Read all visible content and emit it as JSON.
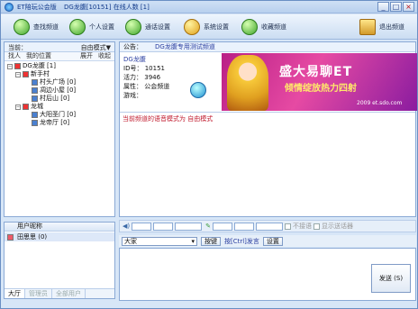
{
  "window": {
    "app_name": "ET陪玩公会版",
    "channel_info": "DG龙腹[10151] 在线人数 [1]",
    "minimize": "_",
    "maximize": "□",
    "close": "×"
  },
  "toolbar": {
    "find_channel": "查找频道",
    "personal_settings": "个人设置",
    "call_settings": "通话设置",
    "system_settings": "系统设置",
    "favorite_channel": "收藏频道",
    "exit_channel": "退出频道"
  },
  "left": {
    "current_label": "当前：",
    "mode_value": "自由模式▼",
    "tab_find": "找人",
    "tab_my_position": "我的位置",
    "expand": "展开",
    "collapse": "收起",
    "tree": [
      {
        "label": "DG龙腹 [1]",
        "level": 0,
        "icon": "red"
      },
      {
        "label": "新手村",
        "level": 1,
        "icon": "red"
      },
      {
        "label": "村头广场 [0]",
        "level": 2,
        "icon": "blue"
      },
      {
        "label": "凋边小屋 [0]",
        "level": 2,
        "icon": "blue"
      },
      {
        "label": "村后山 [0]",
        "level": 2,
        "icon": "blue"
      },
      {
        "label": "龙城",
        "level": 1,
        "icon": "red"
      },
      {
        "label": "大阳圣门 [0]",
        "level": 2,
        "icon": "blue"
      },
      {
        "label": "龙帝厅 [0]",
        "level": 2,
        "icon": "blue"
      }
    ]
  },
  "users": {
    "header": "用户昵称",
    "list": [
      "田思思 (0)"
    ],
    "tabs": [
      "大厅",
      "管理员",
      "全部用户"
    ]
  },
  "main": {
    "announce_label": "公告：",
    "announce_text": "DG龙腹专用测试频道",
    "info_name": "DG龙腹",
    "info_id_label": "ID号：",
    "info_id": "10151",
    "info_activity_label": "活力：",
    "info_activity": "3946",
    "info_attr_label": "属性：",
    "info_attr": "公会频道",
    "info_desc_label": "游戏：",
    "banner_title": "盛大易聊ET",
    "banner_sub": "倾情绽放热力四射",
    "banner_url": "2009 et.sdo.com",
    "chat_message": "当前频道的语音模式为 自由模式"
  },
  "controls": {
    "opt1": "不接语",
    "opt2": "显示送话器",
    "recipient": "大家",
    "key_button": "按键",
    "send_hint": "按[Ctrl]发言",
    "settings_button": "设置",
    "send_button": "发送 (S)"
  }
}
